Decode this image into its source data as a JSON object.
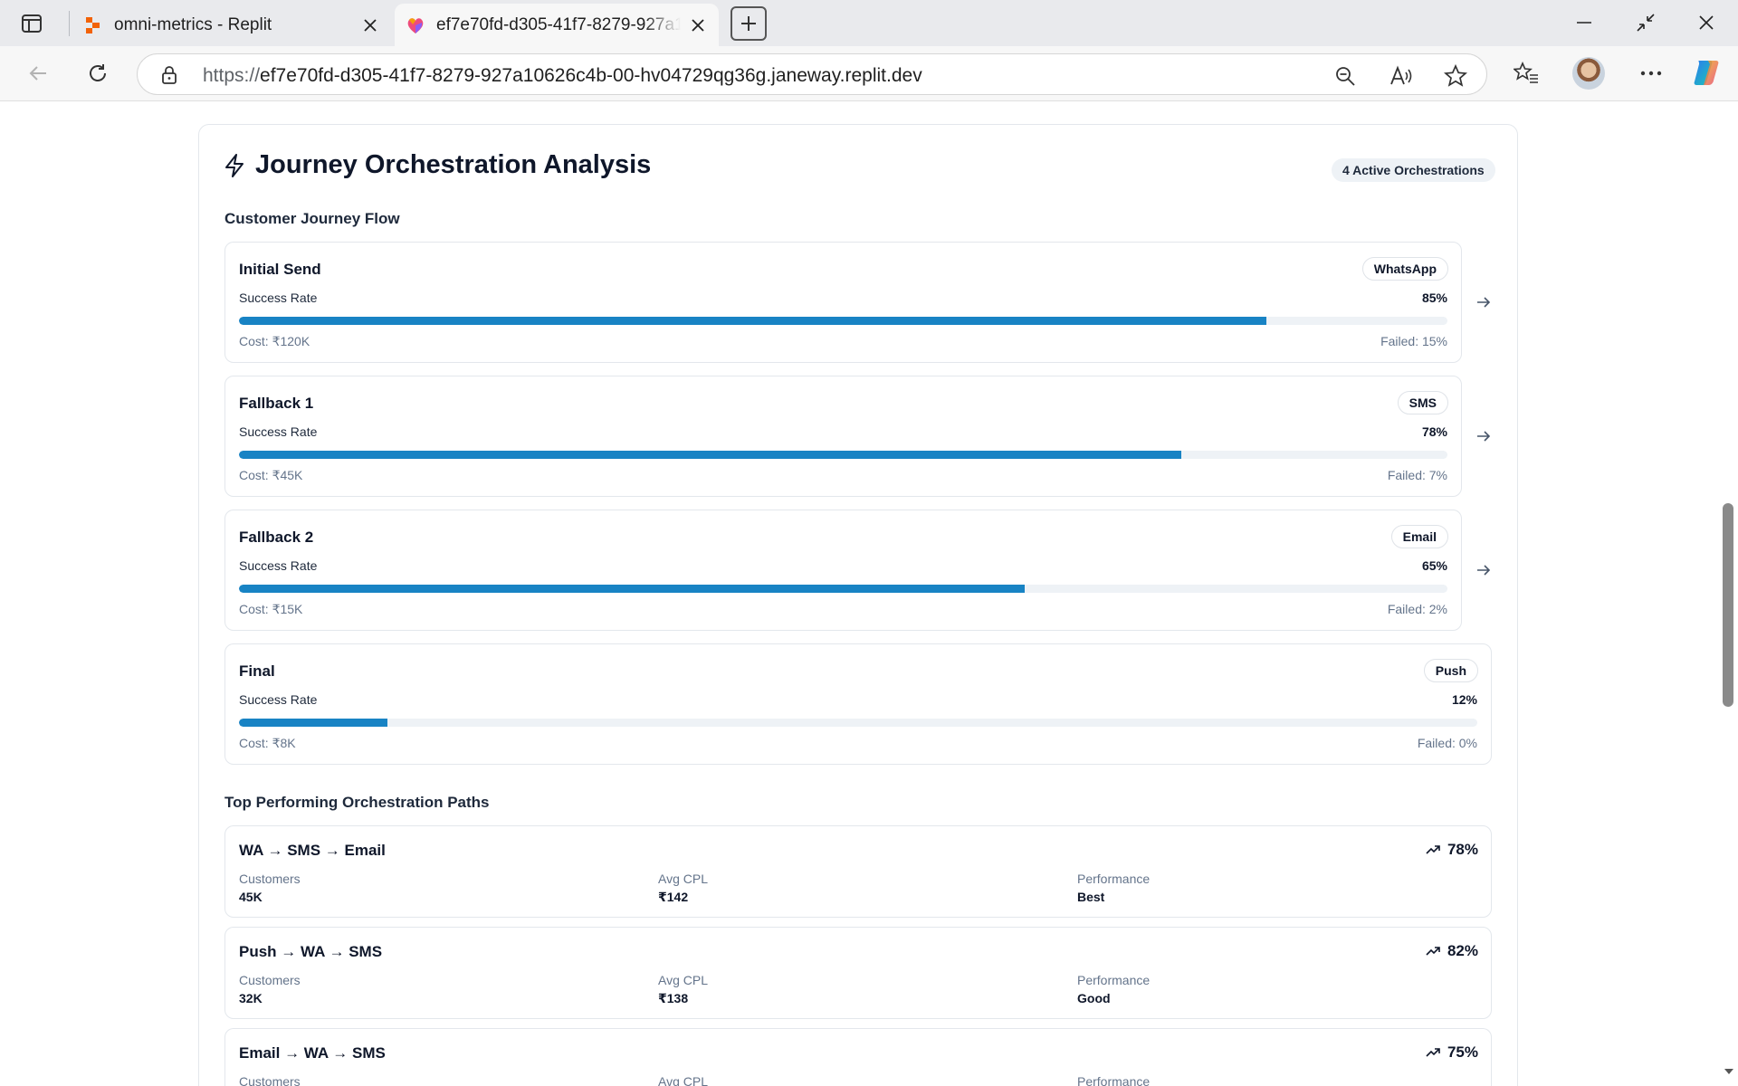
{
  "browser": {
    "tabs": [
      {
        "title": "omni-metrics - Replit"
      },
      {
        "title": "ef7e70fd-d305-41f7-8279-927a10626c4b-00-hv04729qg36g.janeway.replit.dev"
      }
    ],
    "url": {
      "scheme": "https://",
      "host": "ef7e70fd-d305-41f7-8279-927a10626c4b-00-hv04729qg36g.janeway.replit.dev"
    }
  },
  "page": {
    "title": "Journey Orchestration Analysis",
    "active_badge": "4 Active Orchestrations",
    "flow_heading": "Customer Journey Flow",
    "paths_heading": "Top Performing Orchestration Paths",
    "steps": [
      {
        "name": "Initial Send",
        "channel": "WhatsApp",
        "success_label": "Success Rate",
        "success_rate": "85%",
        "success_fraction": 0.85,
        "cost": "Cost: ₹120K",
        "failed": "Failed: 15%"
      },
      {
        "name": "Fallback 1",
        "channel": "SMS",
        "success_label": "Success Rate",
        "success_rate": "78%",
        "success_fraction": 0.78,
        "cost": "Cost: ₹45K",
        "failed": "Failed: 7%"
      },
      {
        "name": "Fallback 2",
        "channel": "Email",
        "success_label": "Success Rate",
        "success_rate": "65%",
        "success_fraction": 0.65,
        "cost": "Cost: ₹15K",
        "failed": "Failed: 2%"
      },
      {
        "name": "Final",
        "channel": "Push",
        "success_label": "Success Rate",
        "success_rate": "12%",
        "success_fraction": 0.12,
        "cost": "Cost: ₹8K",
        "failed": "Failed: 0%"
      }
    ],
    "paths": [
      {
        "name": "WA → SMS → Email",
        "rate": "78%",
        "customers_label": "Customers",
        "customers": "45K",
        "cpl_label": "Avg CPL",
        "cpl": "₹142",
        "performance_label": "Performance",
        "performance": "Best"
      },
      {
        "name": "Push → WA → SMS",
        "rate": "82%",
        "customers_label": "Customers",
        "customers": "32K",
        "cpl_label": "Avg CPL",
        "cpl": "₹138",
        "performance_label": "Performance",
        "performance": "Good"
      },
      {
        "name": "Email → WA → SMS",
        "rate": "75%",
        "customers_label": "Customers",
        "customers": "",
        "cpl_label": "Avg CPL",
        "cpl": "",
        "performance_label": "Performance",
        "performance": ""
      }
    ]
  },
  "colors": {
    "progress_fill": "#1883c4",
    "progress_track": "#eef2f6",
    "card_border": "#e3e7ec"
  },
  "icons": {
    "flow_arrow": "arrow-right-icon",
    "path_trend": "trending-up-icon",
    "title": "zap-icon"
  }
}
